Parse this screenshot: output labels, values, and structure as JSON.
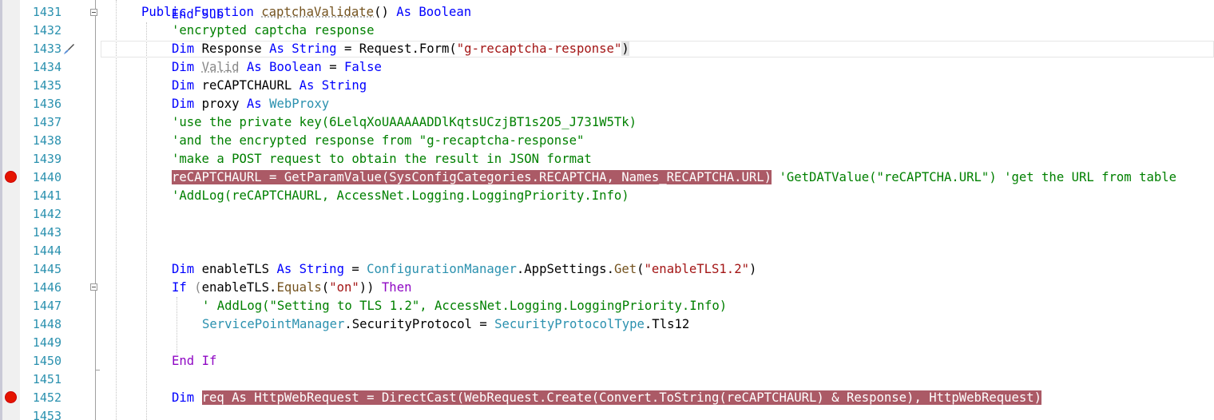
{
  "editor": {
    "line_numbers": [
      "1431",
      "1432",
      "1433",
      "1434",
      "1435",
      "1436",
      "1437",
      "1438",
      "1439",
      "1440",
      "1441",
      "1442",
      "1443",
      "1444",
      "1445",
      "1446",
      "1447",
      "1448",
      "1449",
      "1450",
      "1451",
      "1452",
      "1453"
    ],
    "top_partial_text": "End Sub",
    "lines": {
      "l1431": {
        "kw_public": "Public",
        "kw_function": "Function",
        "fn_name": "captchaValidate",
        "parens": "()",
        "kw_as": "As",
        "kw_type": "Boolean"
      },
      "l1432": {
        "comment": "'encrypted captcha response"
      },
      "l1433": {
        "kw_dim": "Dim",
        "var": "Response",
        "kw_as": "As",
        "kw_type": "String",
        "assign": "= Request.Form(",
        "str": "\"g-recaptcha-response\"",
        "close": ")"
      },
      "l1434": {
        "kw_dim": "Dim",
        "var": "Valid",
        "kw_as": "As",
        "kw_type": "Boolean",
        "eq": "=",
        "kw_false": "False"
      },
      "l1435": {
        "kw_dim": "Dim",
        "var": "reCAPTCHAURL",
        "kw_as": "As",
        "kw_type": "String"
      },
      "l1436": {
        "kw_dim": "Dim",
        "var": "proxy",
        "kw_as": "As",
        "cls": "WebProxy"
      },
      "l1437": {
        "comment": "'use the private key(6LelqXoUAAAAADDlKqtsUCzjBT1s2O5_J731W5Tk)"
      },
      "l1438": {
        "comment": "'and the encrypted response from \"g-recaptcha-response\""
      },
      "l1439": {
        "comment": "'make a POST request to obtain the result in JSON format"
      },
      "l1440": {
        "highlight": "reCAPTCHAURL = GetParamValue(SysConfigCategories.RECAPTCHA, Names_RECAPTCHA.URL)",
        "comment": "'GetDATValue(\"reCAPTCHA.URL\") 'get the URL from table"
      },
      "l1441": {
        "comment": "'AddLog(reCAPTCHAURL, AccessNet.Logging.LoggingPriority.Info)"
      },
      "l1445": {
        "kw_dim": "Dim",
        "var": "enableTLS",
        "kw_as": "As",
        "kw_type": "String",
        "eq": "=",
        "cls": "ConfigurationManager",
        "mid": ".AppSettings.",
        "fn": "Get",
        "open": "(",
        "str": "\"enableTLS1.2\"",
        "close": ")"
      },
      "l1446": {
        "kw_if": "If",
        "open": "(",
        "obj": "enableTLS.",
        "fn": "Equals",
        "open2": "(",
        "str": "\"on\"",
        "close": "))",
        "kw_then": "Then"
      },
      "l1447": {
        "comment": "' AddLog(\"Setting to TLS 1.2\", AccessNet.Logging.LoggingPriority.Info)"
      },
      "l1448": {
        "cls1": "ServicePointManager",
        "mid": ".SecurityProtocol = ",
        "cls2": "SecurityProtocolType",
        "tail": ".Tls12"
      },
      "l1450": {
        "kw_end": "End",
        "kw_if": "If"
      },
      "l1452": {
        "kw_dim": "Dim",
        "highlight": "req As HttpWebRequest = DirectCast(WebRequest.Create(Convert.ToString(reCAPTCHAURL) & Response), HttpWebRequest)"
      }
    },
    "breakpoints": [
      "1440",
      "1452"
    ],
    "colors": {
      "keyword": "#0000ff",
      "type": "#2b91af",
      "string": "#a31515",
      "comment": "#008000",
      "line_number": "#2b91af",
      "breakpoint": "#e51400",
      "breakpoint_highlight": "#ab5a66"
    },
    "icons": [
      "breakpoint-icon",
      "quick-action-brush-icon",
      "collapse-icon"
    ]
  }
}
